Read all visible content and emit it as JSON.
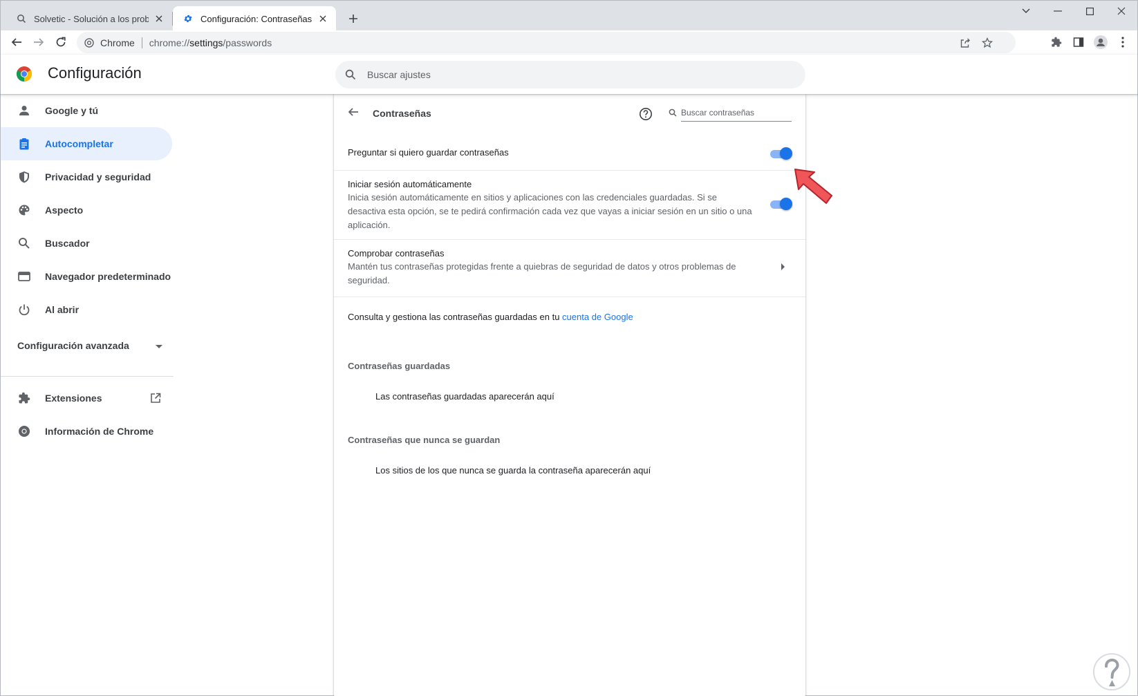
{
  "browser": {
    "tabs": [
      {
        "title": "Solvetic - Solución a los problem",
        "favicon": "solvetic-search-icon",
        "active": false
      },
      {
        "title": "Configuración: Contraseñas",
        "favicon": "gear-icon",
        "active": true
      }
    ],
    "omnibox": {
      "site_chip": "Chrome",
      "url_scheme": "chrome://",
      "url_host": "settings",
      "url_path": "/passwords"
    }
  },
  "settings": {
    "title": "Configuración",
    "search_placeholder": "Buscar ajustes"
  },
  "sidebar": {
    "items": [
      {
        "label": "Google y tú",
        "icon": "person-icon"
      },
      {
        "label": "Autocompletar",
        "icon": "clipboard-icon",
        "selected": true
      },
      {
        "label": "Privacidad y seguridad",
        "icon": "shield-icon"
      },
      {
        "label": "Aspecto",
        "icon": "palette-icon"
      },
      {
        "label": "Buscador",
        "icon": "search-icon"
      },
      {
        "label": "Navegador predeterminado",
        "icon": "browser-window-icon"
      },
      {
        "label": "Al abrir",
        "icon": "power-icon"
      }
    ],
    "advanced_label": "Configuración avanzada",
    "extensions_label": "Extensiones",
    "about_label": "Información de Chrome"
  },
  "passwords": {
    "title": "Contraseñas",
    "search_placeholder": "Buscar contraseñas",
    "offer_to_save": {
      "label": "Preguntar si quiero guardar contraseñas",
      "enabled": true
    },
    "auto_signin": {
      "label": "Iniciar sesión automáticamente",
      "description": "Inicia sesión automáticamente en sitios y aplicaciones con las credenciales guardadas. Si se desactiva esta opción, se te pedirá confirmación cada vez que vayas a iniciar sesión en un sitio o una aplicación.",
      "enabled": true
    },
    "check": {
      "label": "Comprobar contraseñas",
      "description": "Mantén tus contraseñas protegidas frente a quiebras de seguridad de datos y otros problemas de seguridad."
    },
    "manage_text": "Consulta y gestiona las contraseñas guardadas en tu",
    "manage_link": "cuenta de Google",
    "saved_heading": "Contraseñas guardadas",
    "saved_empty": "Las contraseñas guardadas aparecerán aquí",
    "never_heading": "Contraseñas que nunca se guardan",
    "never_empty": "Los sitios de los que nunca se guarda la contraseña aparecerán aquí"
  },
  "colors": {
    "accent": "#1a73e8",
    "toggle_track": "#8ab4f8",
    "selected_bg": "#e8f0fe",
    "annotation_arrow": "#f0555a"
  }
}
